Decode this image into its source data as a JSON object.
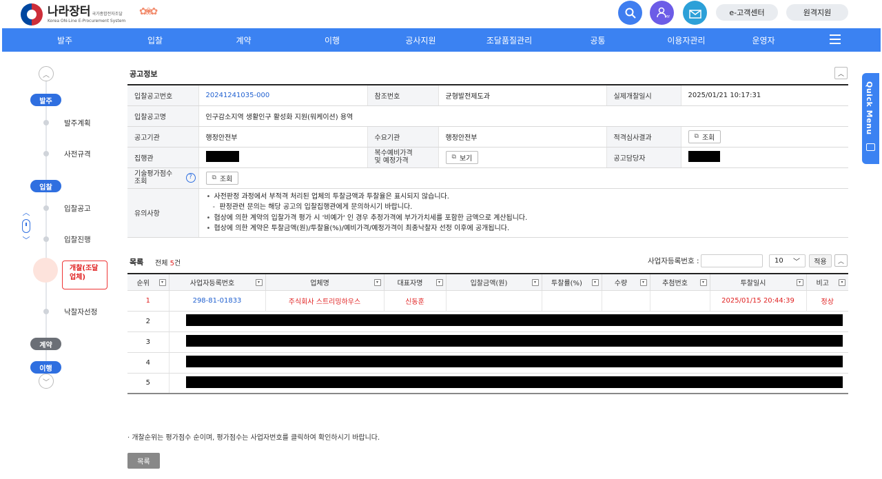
{
  "header": {
    "logo_main": "나라장터",
    "logo_sub1": "국가종합전자조달",
    "logo_sub2": "Korea ON-Line E-Procurement System",
    "search_icon": "search-icon",
    "my_label": "MY",
    "cs_button": "e-고객센터",
    "remote_button": "원격지원"
  },
  "nav": {
    "items": [
      "발주",
      "입찰",
      "계약",
      "이행",
      "공사지원",
      "조달품질관리",
      "공통",
      "이용자관리",
      "운영자"
    ]
  },
  "sidebar": {
    "phases": [
      {
        "label": "발주",
        "steps": [
          "발주계획",
          "사전규격"
        ]
      },
      {
        "label": "입찰",
        "steps": [
          "입찰공고",
          "입찰진행",
          "개찰(조달업체)",
          "낙찰자선정"
        ]
      },
      {
        "label": "계약",
        "steps": []
      },
      {
        "label": "이행",
        "steps": []
      }
    ],
    "active_step": "개찰(조달업체)",
    "active_line1": "개찰(조달",
    "active_line2": "업체)"
  },
  "quick_menu": {
    "label": "Quick Menu"
  },
  "notice_section": {
    "title": "공고정보",
    "rows": {
      "bid_no_label": "입찰공고번호",
      "bid_no_value": "20241241035-000",
      "ref_no_label": "참조번호",
      "ref_no_value": "균형발전제도과",
      "open_dt_label": "실제개찰일시",
      "open_dt_value": "2025/01/21 10:17:31",
      "bid_name_label": "입찰공고명",
      "bid_name_value": "인구감소지역 생활인구 활성화 지원(워케이션) 용역",
      "org_label": "공고기관",
      "org_value": "행정안전부",
      "demand_label": "수요기관",
      "demand_value": "행정안전부",
      "qual_label": "적격심사결과",
      "view_btn": "조회",
      "exec_label": "집행관",
      "multi_price_label_1": "복수예비가격",
      "multi_price_label_2": "및 예정가격",
      "see_btn": "보기",
      "manager_label": "공고담당자",
      "tech_label_1": "기술평가점수",
      "tech_label_2": "조회",
      "tech_btn": "조회",
      "notes_label": "유의사항",
      "notes": [
        "사전판정 과정에서 부적격 처리된 업체의 투찰금액과 투찰율은 표시되지 않습니다.",
        "판정관련 문의는 해당 공고의 입찰집행관에게 문의하시기 바랍니다.",
        "협상에 의한 계약의 입찰가격 평가 시 '비예가' 인 경우 추정가격에 부가가치세를 포함한 금액으로 계산됩니다.",
        "협상에 의한 계약은 투찰금액(원)/투찰율(%)/예비가격/예정가격이 최종낙찰자 선정 이후에 공개됩니다."
      ]
    }
  },
  "list_section": {
    "title": "목록",
    "count_prefix": "전체 ",
    "count_value": "5",
    "count_suffix": "건",
    "biz_no_label": "사업자등록번호 :",
    "page_size": "10",
    "apply_btn": "적용",
    "columns": [
      "순위",
      "사업자등록번호",
      "업체명",
      "대표자명",
      "입찰금액(원)",
      "투찰률(%)",
      "수량",
      "추첨번호",
      "투찰일시",
      "비고"
    ],
    "rows": [
      {
        "rank": "1",
        "biz_no": "298-81-01833",
        "company": "주식회사 스트리밍하우스",
        "ceo": "신동훈",
        "amount": "",
        "rate": "",
        "qty": "",
        "draw": "",
        "bid_dt": "2025/01/15 20:44:39",
        "note": "정상"
      },
      {
        "rank": "2"
      },
      {
        "rank": "3"
      },
      {
        "rank": "4"
      },
      {
        "rank": "5"
      }
    ],
    "footnote": "개찰순위는 평가점수 순이며, 평가점수는 사업자번호를 클릭하여 확인하시기 바랍니다.",
    "list_btn": "목록"
  }
}
